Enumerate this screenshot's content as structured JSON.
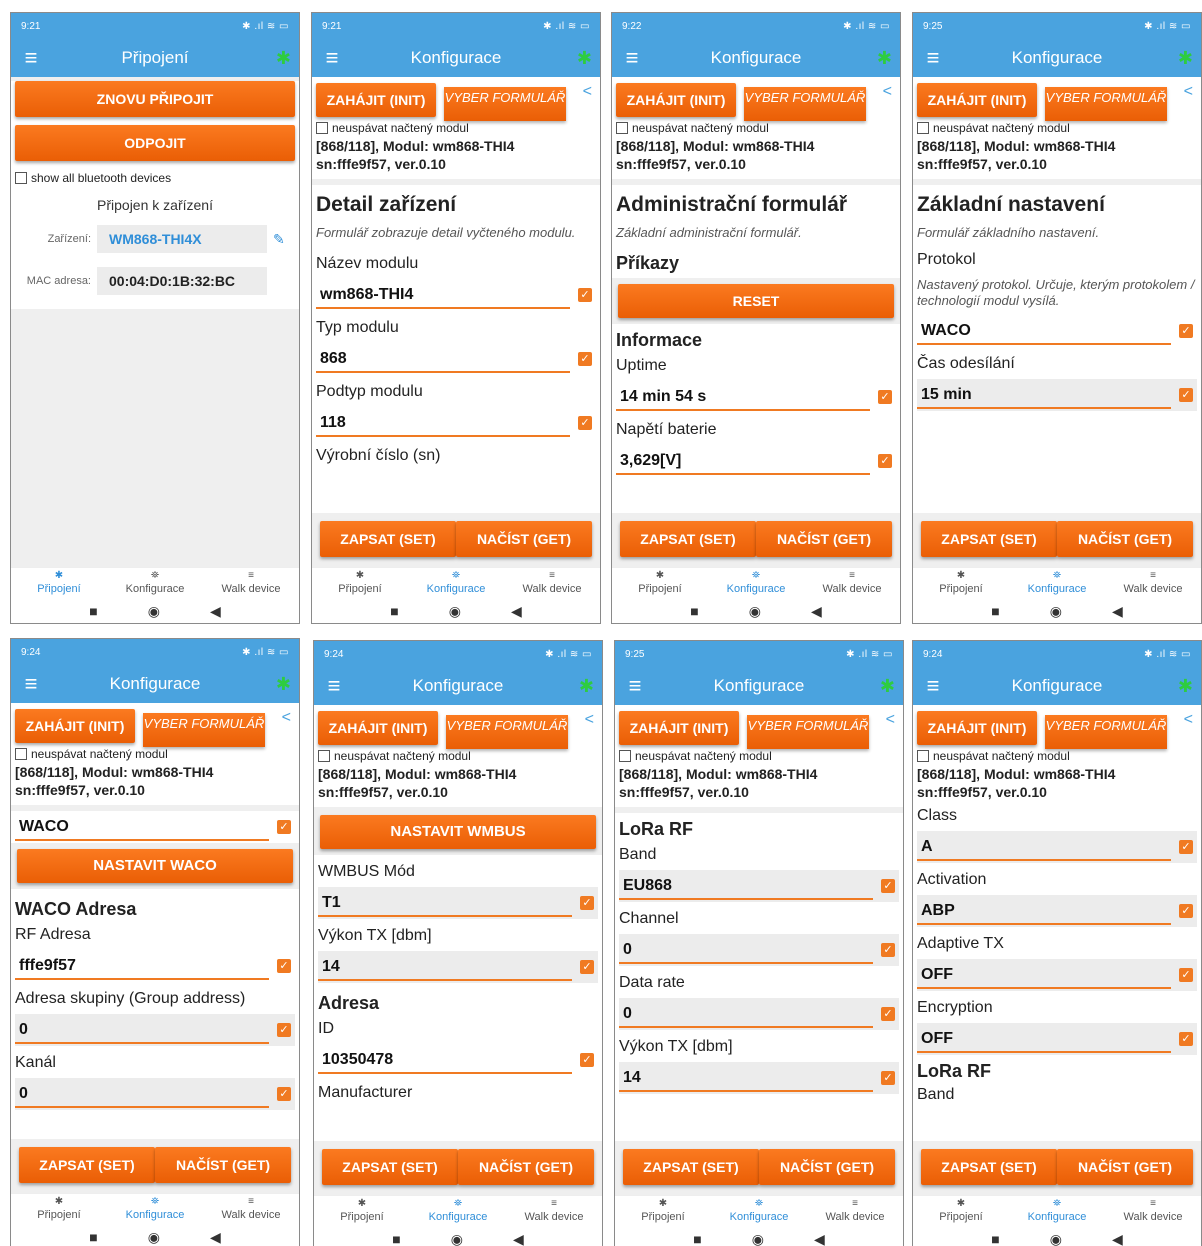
{
  "common": {
    "menu_icon": "hamburger-icon",
    "bluetooth_icon": "bluetooth-icon",
    "btn_init": "ZAHÁJIT (INIT)",
    "btn_form": "VYBER FORMULÁŘ",
    "share_icon": "share-icon",
    "no_sleep": "neuspávat načtený modul",
    "modinfo_line1": "[868/118], Modul: wm868-THI4",
    "modinfo_line2": "sn:fffe9f57, ver.0.10",
    "btn_set": "ZAPSAT (SET)",
    "btn_get": "NAČÍST (GET)",
    "nav_pripojeni": "Připojení",
    "nav_konfigurace": "Konfigurace",
    "nav_walk": "Walk device",
    "title_konfigurace": "Konfigurace",
    "accent_orange": "#f07a22",
    "appbar_blue": "#4aa3df"
  },
  "p1": {
    "time": "9:21",
    "title": "Připojení",
    "btn_reconnect": "ZNOVU PŘIPOJIT",
    "btn_disconnect": "ODPOJIT",
    "show_all": "show all bluetooth devices",
    "connected_to": "Připojen k zařízení",
    "device_label": "Zařízení:",
    "device_value": "WM868-THI4X",
    "mac_label": "MAC adresa:",
    "mac_value": "00:04:D0:1B:32:BC"
  },
  "p2": {
    "time": "9:21",
    "heading": "Detail zařízení",
    "desc": "Formulář zobrazuje detail vyčteného modulu.",
    "l1": "Název modulu",
    "v1": "wm868-THI4",
    "l2": "Typ modulu",
    "v2": "868",
    "l3": "Podtyp modulu",
    "v3": "118",
    "l4": "Výrobní číslo (sn)"
  },
  "p3": {
    "time": "9:22",
    "heading": "Administrační formulář",
    "desc": "Základní administrační formulář.",
    "commands": "Příkazy",
    "btn_reset": "RESET",
    "info": "Informace",
    "l1": "Uptime",
    "v1": "14 min 54 s",
    "l2": "Napětí baterie",
    "v2": "3,629[V]"
  },
  "p4": {
    "time": "9:25",
    "heading": "Základní nastavení",
    "desc": "Formulář základního nastavení.",
    "l1": "Protokol",
    "desc2": "Nastavený protokol. Určuje, kterým protokolem / technologií modul vysílá.",
    "v1": "WACO",
    "l2": "Čas odesílání",
    "v2": "15 min"
  },
  "p5": {
    "time": "9:24",
    "v0": "WACO",
    "btn_set_waco": "NASTAVIT WACO",
    "heading": "WACO Adresa",
    "l1": "RF Adresa",
    "v1": "fffe9f57",
    "l2": "Adresa skupiny (Group address)",
    "v2": "0",
    "l3": "Kanál",
    "v3": "0"
  },
  "p6": {
    "time": "9:24",
    "btn_set_wmbus": "NASTAVIT WMBUS",
    "l1": "WMBUS Mód",
    "v1": "T1",
    "l2": "Výkon TX [dbm]",
    "v2": "14",
    "heading": "Adresa",
    "l3": "ID",
    "v3": "10350478",
    "l4": "Manufacturer"
  },
  "p7": {
    "time": "9:25",
    "heading": "LoRa RF",
    "l1": "Band",
    "v1": "EU868",
    "l2": "Channel",
    "v2": "0",
    "l3": "Data rate",
    "v3": "0",
    "l4": "Výkon TX [dbm]",
    "v4": "14"
  },
  "p8": {
    "time": "9:24",
    "l1": "Class",
    "v1": "A",
    "l2": "Activation",
    "v2": "ABP",
    "l3": "Adaptive TX",
    "v3": "OFF",
    "l4": "Encryption",
    "v4": "OFF",
    "heading": "LoRa RF",
    "l5": "Band"
  }
}
